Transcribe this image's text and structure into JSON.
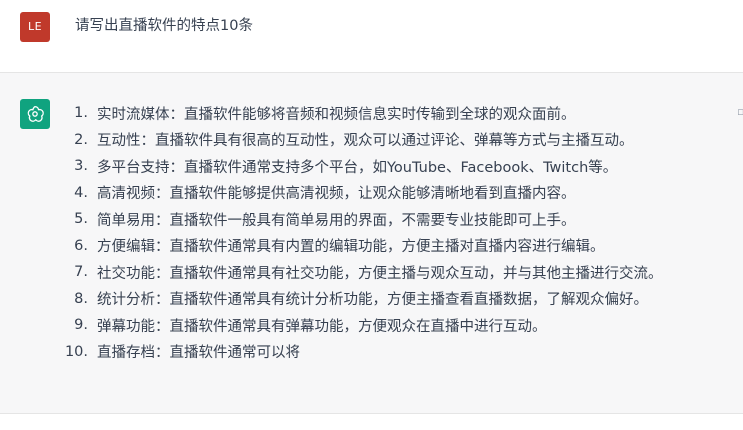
{
  "user": {
    "avatar_initials": "LE",
    "avatar_color": "#c0392b",
    "prompt": "请写出直播软件的特点10条"
  },
  "assistant": {
    "avatar_icon": "openai-logo-icon",
    "avatar_color": "#10a37f",
    "items": [
      {
        "num": "1.",
        "text": "实时流媒体：直播软件能够将音频和视频信息实时传输到全球的观众面前。"
      },
      {
        "num": "2.",
        "text": "互动性：直播软件具有很高的互动性，观众可以通过评论、弹幕等方式与主播互动。"
      },
      {
        "num": "3.",
        "text": "多平台支持：直播软件通常支持多个平台，如YouTube、Facebook、Twitch等。"
      },
      {
        "num": "4.",
        "text": "高清视频：直播软件能够提供高清视频，让观众能够清晰地看到直播内容。"
      },
      {
        "num": "5.",
        "text": "简单易用：直播软件一般具有简单易用的界面，不需要专业技能即可上手。"
      },
      {
        "num": "6.",
        "text": "方便编辑：直播软件通常具有内置的编辑功能，方便主播对直播内容进行编辑。"
      },
      {
        "num": "7.",
        "text": "社交功能：直播软件通常具有社交功能，方便主播与观众互动，并与其他主播进行交流。"
      },
      {
        "num": "8.",
        "text": "统计分析：直播软件通常具有统计分析功能，方便主播查看直播数据，了解观众偏好。"
      },
      {
        "num": "9.",
        "text": "弹幕功能：直播软件通常具有弹幕功能，方便观众在直播中进行互动。"
      },
      {
        "num": "10.",
        "text": "直播存档：直播软件通常可以将"
      }
    ]
  }
}
